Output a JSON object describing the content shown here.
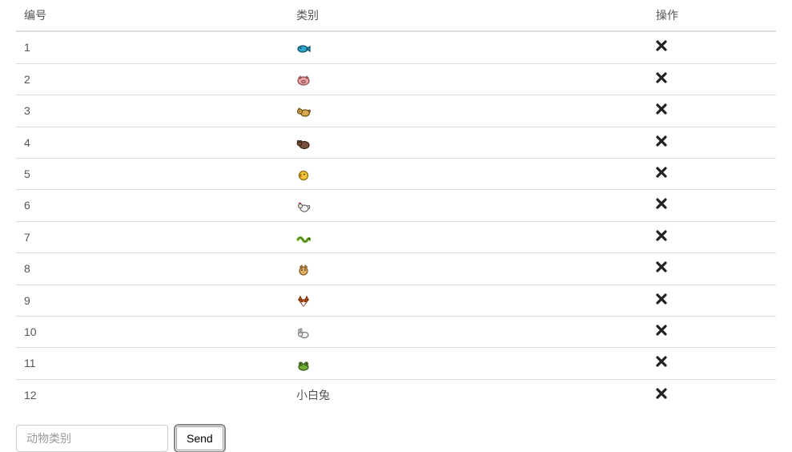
{
  "headers": {
    "id": "编号",
    "category": "类别",
    "action": "操作"
  },
  "rows": [
    {
      "id": "1",
      "category_icon": "fish",
      "category_text": ""
    },
    {
      "id": "2",
      "category_icon": "pig",
      "category_text": ""
    },
    {
      "id": "3",
      "category_icon": "dog",
      "category_text": ""
    },
    {
      "id": "4",
      "category_icon": "bear",
      "category_text": ""
    },
    {
      "id": "5",
      "category_icon": "chick",
      "category_text": ""
    },
    {
      "id": "6",
      "category_icon": "rooster",
      "category_text": ""
    },
    {
      "id": "7",
      "category_icon": "snake",
      "category_text": ""
    },
    {
      "id": "8",
      "category_icon": "cat",
      "category_text": ""
    },
    {
      "id": "9",
      "category_icon": "fox",
      "category_text": ""
    },
    {
      "id": "10",
      "category_icon": "rabbit",
      "category_text": ""
    },
    {
      "id": "11",
      "category_icon": "frog",
      "category_text": ""
    },
    {
      "id": "12",
      "category_icon": "",
      "category_text": "小白兔"
    }
  ],
  "form": {
    "input_placeholder": "动物类别",
    "button_label": "Send"
  },
  "icons": {
    "fish": {
      "body": "#2ba6cc",
      "outline": "#0d4a5e"
    },
    "pig": {
      "body": "#e9a3a3",
      "outline": "#8a4a4a"
    },
    "dog": {
      "body": "#d6a94a",
      "outline": "#6b4e12"
    },
    "bear": {
      "body": "#79513a",
      "outline": "#3b2618"
    },
    "chick": {
      "body": "#f3c43a",
      "outline": "#8a6a0d"
    },
    "rooster": {
      "body": "#f5f5f5",
      "outline": "#666666"
    },
    "snake": {
      "body": "#7dbb3a",
      "outline": "#3c6012"
    },
    "cat": {
      "body": "#e8b06a",
      "outline": "#7a5320"
    },
    "fox": {
      "body": "#e0662a",
      "outline": "#7a2f0a"
    },
    "rabbit": {
      "body": "#f2f2f2",
      "outline": "#777777"
    },
    "frog": {
      "body": "#6fae3a",
      "outline": "#365a14"
    }
  }
}
